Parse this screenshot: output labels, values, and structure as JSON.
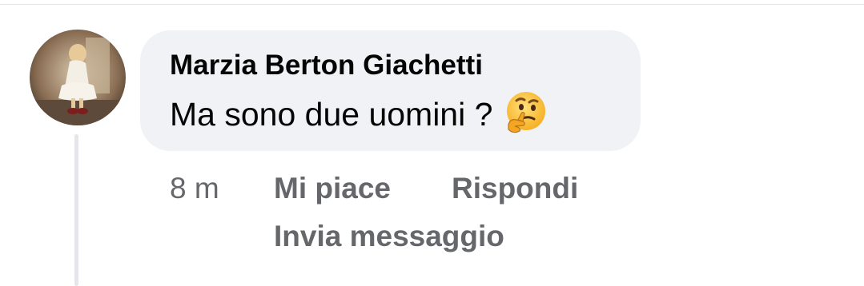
{
  "comment": {
    "author": "Marzia Berton Giachetti",
    "text": "Ma sono due uomini ?",
    "emoji": "thinking-face"
  },
  "meta": {
    "time": "8 m",
    "like_label": "Mi piace",
    "reply_label": "Rispondi",
    "message_label": "Invia messaggio"
  },
  "colors": {
    "bubble_bg": "#f0f2f5",
    "text": "#050505",
    "secondary_text": "#65676b",
    "thread_line": "#e4e6eb"
  }
}
